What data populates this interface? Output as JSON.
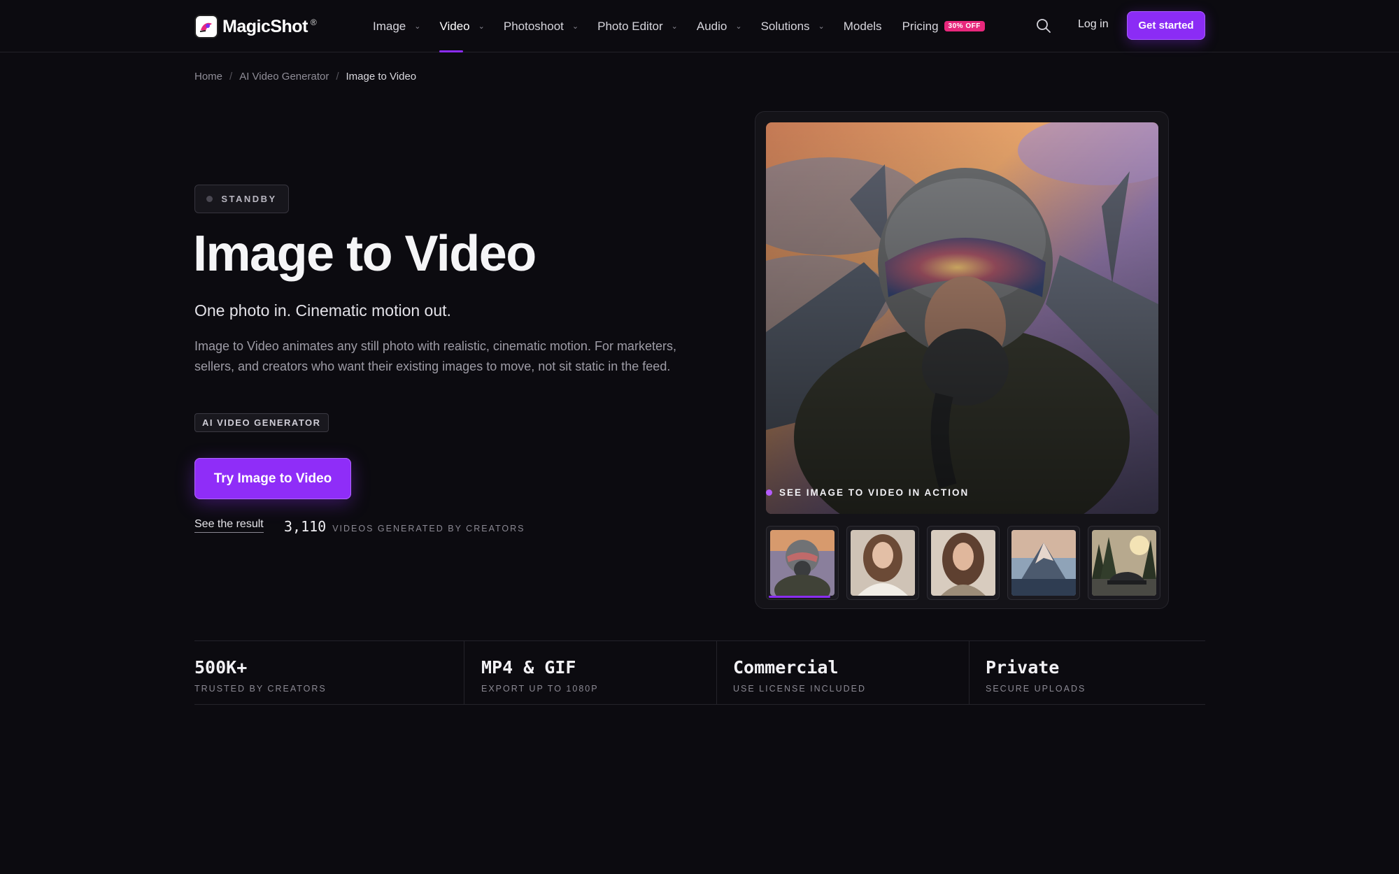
{
  "brand": {
    "name": "MagicShot",
    "reg": "®"
  },
  "nav": {
    "items": [
      {
        "label": "Image",
        "dropdown": true
      },
      {
        "label": "Video",
        "dropdown": true,
        "active": true
      },
      {
        "label": "Photoshoot",
        "dropdown": true
      },
      {
        "label": "Photo Editor",
        "dropdown": true
      },
      {
        "label": "Audio",
        "dropdown": true
      },
      {
        "label": "Solutions",
        "dropdown": true
      },
      {
        "label": "Models",
        "dropdown": false
      },
      {
        "label": "Pricing",
        "dropdown": false,
        "badge": "30% OFF"
      }
    ],
    "login": "Log in",
    "cta": "Get started"
  },
  "breadcrumb": {
    "home": "Home",
    "parent": "AI Video Generator",
    "current": "Image to Video",
    "separator": "/"
  },
  "hero": {
    "status": "STANDBY",
    "title": "Image to Video",
    "subtitle": "One photo in. Cinematic motion out.",
    "description": "Image to Video animates any still photo with realistic, cinematic motion. For marketers, sellers, and creators who want their existing images to move, not sit static in the feed.",
    "tag": "AI VIDEO GENERATOR",
    "cta": "Try Image to Video",
    "see_result": "See the result",
    "count": "3,110",
    "count_label": "VIDEOS GENERATED BY CREATORS"
  },
  "media": {
    "caption": "SEE IMAGE TO VIDEO IN ACTION",
    "thumbnails": [
      "pilot-thumb",
      "woman-white-shirt-thumb",
      "woman-portrait-thumb",
      "mountain-thumb",
      "car-forest-thumb"
    ],
    "active_thumbnail": 0
  },
  "stats": [
    {
      "value": "500K+",
      "label": "TRUSTED BY CREATORS"
    },
    {
      "value": "MP4 & GIF",
      "label": "EXPORT UP TO 1080P"
    },
    {
      "value": "Commercial",
      "label": "USE LICENSE INCLUDED"
    },
    {
      "value": "Private",
      "label": "SECURE UPLOADS"
    }
  ],
  "colors": {
    "accent": "#8b2cf5",
    "badge": "#e8287c",
    "background": "#0c0b10"
  }
}
